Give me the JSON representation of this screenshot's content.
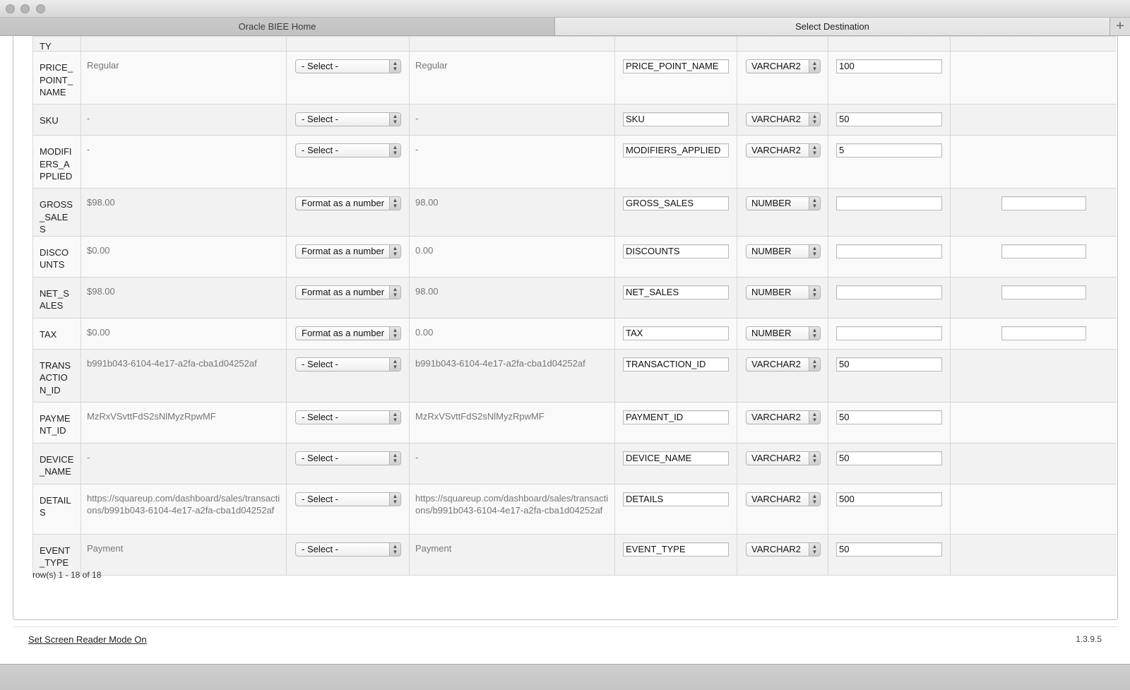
{
  "window": {
    "tabs": [
      {
        "label": "Oracle BIEE Home"
      },
      {
        "label": "Select Destination"
      }
    ],
    "add_tab_symbol": "+"
  },
  "table": {
    "partial_row_text": "TY",
    "rows": [
      {
        "column": "PRICE_POINT_NAME",
        "sample": "Regular",
        "format": "- Select -",
        "preview": "Regular",
        "target_name": "PRICE_POINT_NAME",
        "data_type": "VARCHAR2",
        "length": "100",
        "has_extra": false
      },
      {
        "column": "SKU",
        "sample": "-",
        "format": "- Select -",
        "preview": "-",
        "target_name": "SKU",
        "data_type": "VARCHAR2",
        "length": "50",
        "has_extra": false
      },
      {
        "column": "MODIFIERS_APPLIED",
        "sample": "-",
        "format": "- Select -",
        "preview": "-",
        "target_name": "MODIFIERS_APPLIED",
        "data_type": "VARCHAR2",
        "length": "5",
        "has_extra": false
      },
      {
        "column": "GROSS_SALES",
        "sample": "$98.00",
        "format": "Format as a number",
        "preview": "98.00",
        "target_name": "GROSS_SALES",
        "data_type": "NUMBER",
        "length": "",
        "has_extra": true
      },
      {
        "column": "DISCOUNTS",
        "sample": "$0.00",
        "format": "Format as a number",
        "preview": "0.00",
        "target_name": "DISCOUNTS",
        "data_type": "NUMBER",
        "length": "",
        "has_extra": true
      },
      {
        "column": "NET_SALES",
        "sample": "$98.00",
        "format": "Format as a number",
        "preview": "98.00",
        "target_name": "NET_SALES",
        "data_type": "NUMBER",
        "length": "",
        "has_extra": true
      },
      {
        "column": "TAX",
        "sample": "$0.00",
        "format": "Format as a number",
        "preview": "0.00",
        "target_name": "TAX",
        "data_type": "NUMBER",
        "length": "",
        "has_extra": true
      },
      {
        "column": "TRANSACTION_ID",
        "sample": "b991b043-6104-4e17-a2fa-cba1d04252af",
        "format": "- Select -",
        "preview": "b991b043-6104-4e17-a2fa-cba1d04252af",
        "target_name": "TRANSACTION_ID",
        "data_type": "VARCHAR2",
        "length": "50",
        "has_extra": false
      },
      {
        "column": "PAYMENT_ID",
        "sample": "MzRxVSvttFdS2sNlMyzRpwMF",
        "format": "- Select -",
        "preview": "MzRxVSvttFdS2sNlMyzRpwMF",
        "target_name": "PAYMENT_ID",
        "data_type": "VARCHAR2",
        "length": "50",
        "has_extra": false
      },
      {
        "column": "DEVICE_NAME",
        "sample": "-",
        "format": "- Select -",
        "preview": "-",
        "target_name": "DEVICE_NAME",
        "data_type": "VARCHAR2",
        "length": "50",
        "has_extra": false
      },
      {
        "column": "DETAILS",
        "sample": "https://squareup.com/dashboard/sales/transactions/b991b043-6104-4e17-a2fa-cba1d04252af",
        "format": "- Select -",
        "preview": "https://squareup.com/dashboard/sales/transactions/b991b043-6104-4e17-a2fa-cba1d04252af",
        "target_name": "DETAILS",
        "data_type": "VARCHAR2",
        "length": "500",
        "has_extra": false
      },
      {
        "column": "EVENT_TYPE",
        "sample": "Payment",
        "format": "- Select -",
        "preview": "Payment",
        "target_name": "EVENT_TYPE",
        "data_type": "VARCHAR2",
        "length": "50",
        "has_extra": false
      }
    ],
    "row_count": "row(s) 1 - 18 of 18"
  },
  "footer": {
    "screen_reader_link": "Set Screen Reader Mode On",
    "version": "1.3.9.5"
  }
}
